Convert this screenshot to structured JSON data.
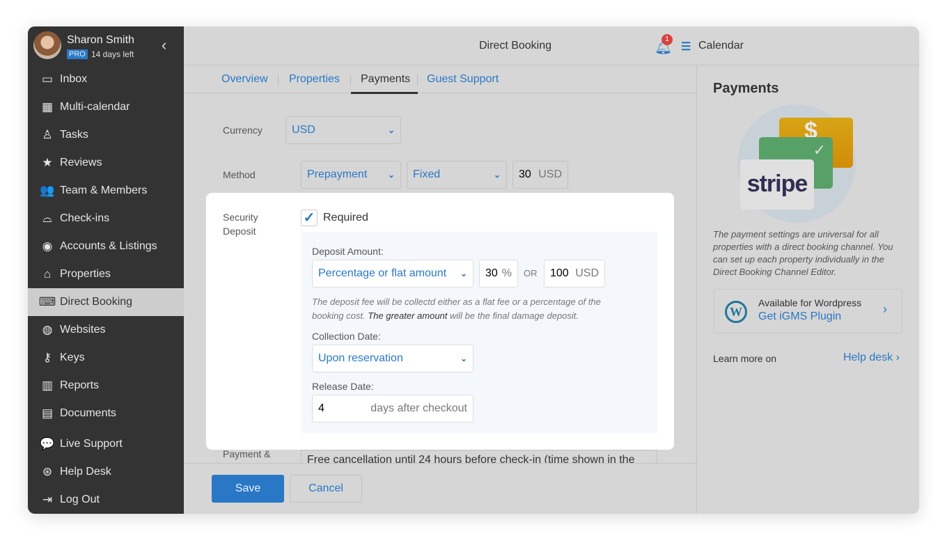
{
  "user": {
    "name": "Sharon Smith",
    "plan": "PRO",
    "trial": "14 days left"
  },
  "sidebar": {
    "items": [
      {
        "label": "Inbox",
        "icon": "inbox-icon",
        "glyph": "▭"
      },
      {
        "label": "Multi-calendar",
        "icon": "calendar-icon",
        "glyph": "▦"
      },
      {
        "label": "Tasks",
        "icon": "tasks-icon",
        "glyph": "♙"
      },
      {
        "label": "Reviews",
        "icon": "star-icon",
        "glyph": "★"
      },
      {
        "label": "Team & Members",
        "icon": "team-icon",
        "glyph": "👥"
      },
      {
        "label": "Check-ins",
        "icon": "bell-service-icon",
        "glyph": "⌓"
      },
      {
        "label": "Accounts & Listings",
        "icon": "account-icon",
        "glyph": "◉"
      },
      {
        "label": "Properties",
        "icon": "home-icon",
        "glyph": "⌂"
      },
      {
        "label": "Direct Booking",
        "icon": "code-window-icon",
        "glyph": "⌨"
      },
      {
        "label": "Websites",
        "icon": "globe-icon",
        "glyph": "◍"
      },
      {
        "label": "Keys",
        "icon": "key-icon",
        "glyph": "⚷"
      },
      {
        "label": "Reports",
        "icon": "bar-chart-icon",
        "glyph": "▥"
      },
      {
        "label": "Documents",
        "icon": "document-icon",
        "glyph": "▤"
      },
      {
        "label": "Live Support",
        "icon": "chat-icon",
        "glyph": "💬"
      },
      {
        "label": "Help Desk",
        "icon": "lifebuoy-icon",
        "glyph": "⊛"
      },
      {
        "label": "Log Out",
        "icon": "logout-icon",
        "glyph": "⇥"
      }
    ],
    "active": "Direct Booking"
  },
  "header": {
    "title": "Direct Booking",
    "notifications": "1",
    "calendar": "Calendar"
  },
  "tabs": [
    "Overview",
    "Properties",
    "Payments",
    "Guest Support"
  ],
  "form": {
    "currency_label": "Currency",
    "currency": "USD",
    "method_label": "Method",
    "method": "Prepayment",
    "method_type": "Fixed",
    "method_amount": "30",
    "method_unit": "USD",
    "deposit_label": "Security Deposit",
    "required_label": "Required",
    "required": true,
    "deposit_amount_label": "Deposit Amount:",
    "deposit_type": "Percentage or flat amount",
    "percent": "30",
    "percent_unit": "%",
    "or": "OR",
    "flat": "100",
    "flat_unit": "USD",
    "note_a": "The deposit fee will be collectd either as a flat fee or a percentage of the booking cost. ",
    "note_bold": "The greater amount",
    "note_b": " will be the final damage deposit.",
    "collection_label": "Collection Date:",
    "collection": "Upon reservation",
    "release_label": "Release Date:",
    "release_days": "4",
    "release_unit": "days after checkout",
    "policy_label": "Payment &",
    "policy_text": "Free cancellation until 24 hours before check-in (time shown in the"
  },
  "actions": {
    "save": "Save",
    "cancel": "Cancel"
  },
  "panel": {
    "title": "Payments",
    "logo": "stripe",
    "desc": "The payment settings are universal for all properties with a direct booking channel. You can set up each property individually in the Direct Booking Channel Editor.",
    "wp_title": "Available for Wordpress",
    "wp_link": "Get iGMS Plugin",
    "learn": "Learn more on",
    "help": "Help desk"
  },
  "colors": {
    "accent": "#2a78c5",
    "sidebar": "#333333",
    "badge": "#d9413f"
  }
}
